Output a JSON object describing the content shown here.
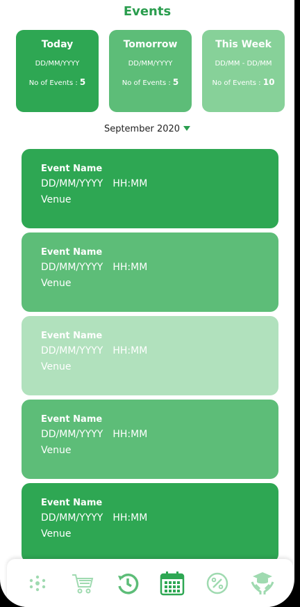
{
  "header": {
    "title": "Events"
  },
  "summary": [
    {
      "title": "Today",
      "date": "DD/MM/YYYY",
      "count_label": "No of Events : ",
      "count": "5",
      "color": "#2ea753"
    },
    {
      "title": "Tomorrow",
      "date": "DD/MM/YYYY",
      "count_label": "No of Events : ",
      "count": "5",
      "color": "#5dbd78"
    },
    {
      "title": "This Week",
      "date": "DD/MM - DD/MM",
      "count_label": "No of Events : ",
      "count": "10",
      "color": "#87d199"
    }
  ],
  "month_selector": {
    "label": "September 2020"
  },
  "events": [
    {
      "name": "Event Name",
      "date": "DD/MM/YYYY",
      "time": "HH:MM",
      "venue": "Venue",
      "color": "#2ea753"
    },
    {
      "name": "Event Name",
      "date": "DD/MM/YYYY",
      "time": "HH:MM",
      "venue": "Venue",
      "color": "#5dbd78"
    },
    {
      "name": "Event Name",
      "date": "DD/MM/YYYY",
      "time": "HH:MM",
      "venue": "Venue",
      "color": "#b1e1bd"
    },
    {
      "name": "Event Name",
      "date": "DD/MM/YYYY",
      "time": "HH:MM",
      "venue": "Venue",
      "color": "#5dbd78"
    },
    {
      "name": "Event Name",
      "date": "DD/MM/YYYY",
      "time": "HH:MM",
      "venue": "Venue",
      "color": "#2ea753"
    }
  ],
  "nav": [
    {
      "icon": "network-icon"
    },
    {
      "icon": "cart-icon"
    },
    {
      "icon": "history-icon"
    },
    {
      "icon": "calendar-icon"
    },
    {
      "icon": "percent-icon"
    },
    {
      "icon": "graduation-hands-icon"
    }
  ]
}
